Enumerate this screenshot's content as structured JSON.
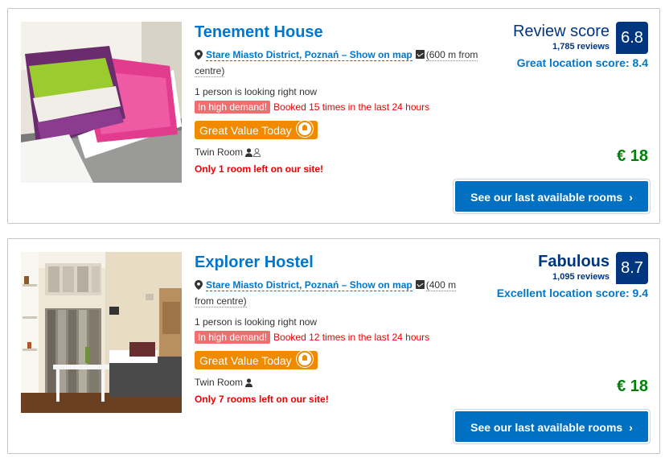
{
  "results": [
    {
      "name": "Tenement House",
      "location_link": "Stare Miasto District, Poznań – Show on map",
      "distance_prefix": "(600 m from",
      "distance_suffix": "centre)",
      "looking": "1 person is looking right now",
      "demand_badge": "In high demand!",
      "demand_text": "Booked 15 times in the last 24 hours",
      "deal_label": "Great Value Today",
      "room_type": "Twin Room",
      "rooms_left": "Only 1 room left on our site!",
      "score_word": "Review score",
      "score_word_bold": false,
      "review_count": "1,785 reviews",
      "score": "6.8",
      "location_score": "Great location score: 8.4",
      "price": "€ 18",
      "cta_label": "See our last available rooms",
      "guest_icons": [
        "person-icon",
        "person-outline-icon"
      ],
      "photo": "bedroom-pillows-photo"
    },
    {
      "name": "Explorer Hostel",
      "location_link": "Stare Miasto District, Poznań – Show on map",
      "distance_prefix": "(400 m",
      "distance_suffix": "from centre)",
      "looking": "1 person is looking right now",
      "demand_badge": "In high demand!",
      "demand_text": "Booked 12 times in the last 24 hours",
      "deal_label": "Great Value Today",
      "room_type": "Twin Room",
      "rooms_left": "Only 7 rooms left on our site!",
      "score_word": "Fabulous",
      "score_word_bold": true,
      "review_count": "1,095 reviews",
      "score": "8.7",
      "location_score": "Excellent location score: 9.4",
      "price": "€ 18",
      "cta_label": "See our last available rooms",
      "guest_icons": [
        "person-icon"
      ],
      "photo": "hostel-room-photo"
    }
  ],
  "colors": {
    "brand_blue": "#003580",
    "link_blue": "#0077cc",
    "button_blue": "#0071c2",
    "price_green": "#008009",
    "alert_red": "#e00000",
    "demand_badge": "#f26d6d",
    "deal_orange": "#f08a00"
  }
}
